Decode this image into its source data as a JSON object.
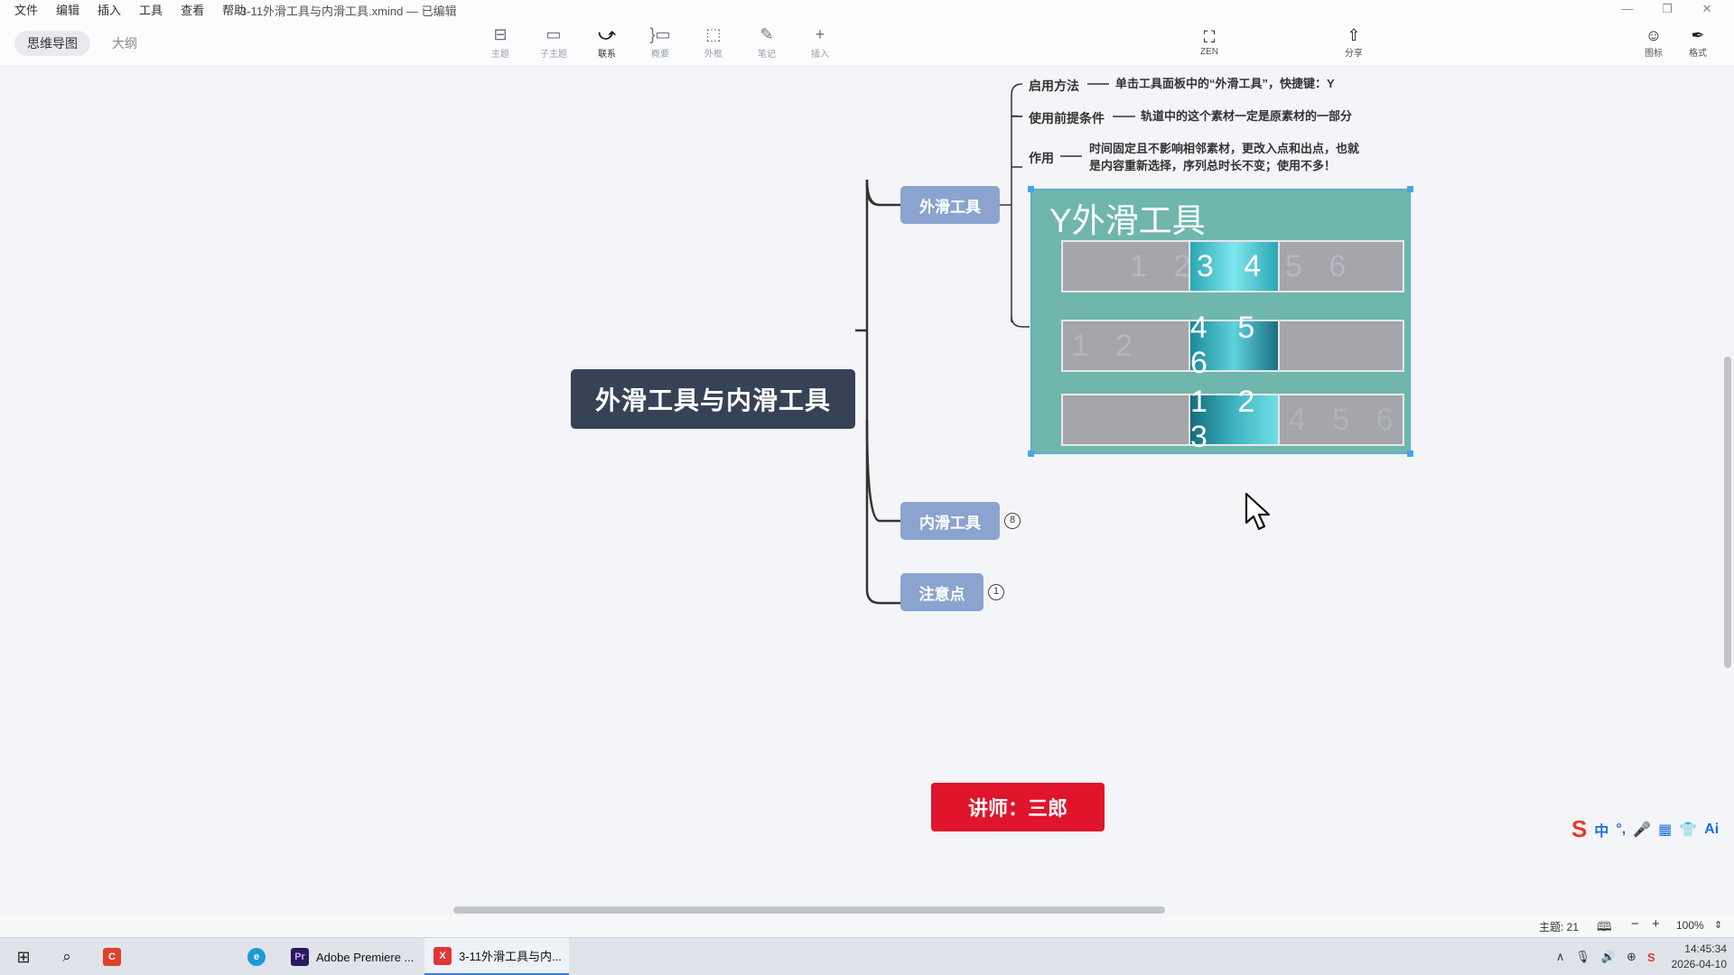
{
  "app": {
    "menu": [
      "文件",
      "编辑",
      "插入",
      "工具",
      "查看",
      "帮助"
    ],
    "doc_title": "3-11外滑工具与内滑工具.xmind — 已编辑",
    "window_controls": [
      "—",
      "❐",
      "✕"
    ]
  },
  "view_tabs": [
    {
      "label": "思维导图",
      "active": true
    },
    {
      "label": "大纲",
      "active": false
    }
  ],
  "toolbar": [
    {
      "icon": "topic-icon",
      "glyph": "⊟",
      "label": "主题"
    },
    {
      "icon": "subtopic-icon",
      "glyph": "▭",
      "label": "子主题"
    },
    {
      "icon": "relationship-icon",
      "glyph": "⤻",
      "label": "联系"
    },
    {
      "icon": "summary-icon",
      "glyph": "}▭",
      "label": "概要"
    },
    {
      "icon": "boundary-icon",
      "glyph": "⬚",
      "label": "外框"
    },
    {
      "icon": "notes-icon",
      "glyph": "✎",
      "label": "笔记"
    },
    {
      "icon": "insert-icon",
      "glyph": "+",
      "label": "插入"
    }
  ],
  "right_tools": {
    "zen": {
      "icon": "zen-icon",
      "glyph": "⛶",
      "label": "ZEN"
    },
    "share": {
      "icon": "share-icon",
      "glyph": "⇧",
      "label": "分享"
    },
    "icon_panel": {
      "icon": "emoji-icon",
      "glyph": "☺",
      "label": "图标"
    },
    "format": {
      "icon": "format-icon",
      "glyph": "✒",
      "label": "格式"
    }
  },
  "map": {
    "central": "外滑工具与内滑工具",
    "branches": {
      "slip": {
        "label": "外滑工具",
        "children": [
          {
            "label": "启用方法",
            "text": "单击工具面板中的“外滑工具”，快捷键：Y"
          },
          {
            "label": "使用前提条件",
            "text": "轨道中的这个素材一定是原素材的一部分"
          },
          {
            "label": "作用",
            "text_line1": "时间固定且不影响相邻素材，更改入点和出点，也就",
            "text_line2": "是内容重新选择，序列总时长不变；使用不多！"
          }
        ]
      },
      "slide": {
        "label": "内滑工具",
        "collapsed_count": "8"
      },
      "notes": {
        "label": "注意点",
        "collapsed_count": "1"
      }
    },
    "image_topic": {
      "title": "Y外滑工具",
      "tracks": [
        {
          "ghost_left": "1 2",
          "clip": "3 4",
          "ghost_right": "5 6"
        },
        {
          "ghost_left": "1 2",
          "clip": "4 5 6",
          "ghost_right": ""
        },
        {
          "ghost_left": "",
          "clip": "1 2 3",
          "ghost_right": "4 5 6"
        }
      ]
    },
    "lecturer": "讲师：三郎"
  },
  "ime": {
    "logo": "S",
    "items": [
      "中",
      "°,",
      "🎤",
      "▦",
      "👕",
      "Ai"
    ]
  },
  "status": {
    "topic_count": "主题: 21",
    "zoom": "100%"
  },
  "taskbar": {
    "apps": [
      {
        "name": "Adobe Premiere ...",
        "icon_text": "Pr"
      },
      {
        "name": "3-11外滑工具与内...",
        "icon_text": "X"
      }
    ],
    "time": "14:45:34",
    "date": "2026-04-10"
  },
  "colors": {
    "central_bg": "#364256",
    "branch_bg": "#8aa4cf",
    "image_bg": "#6fb6ad",
    "lecturer_bg": "#e0142a",
    "selection": "#4aa3e6"
  }
}
